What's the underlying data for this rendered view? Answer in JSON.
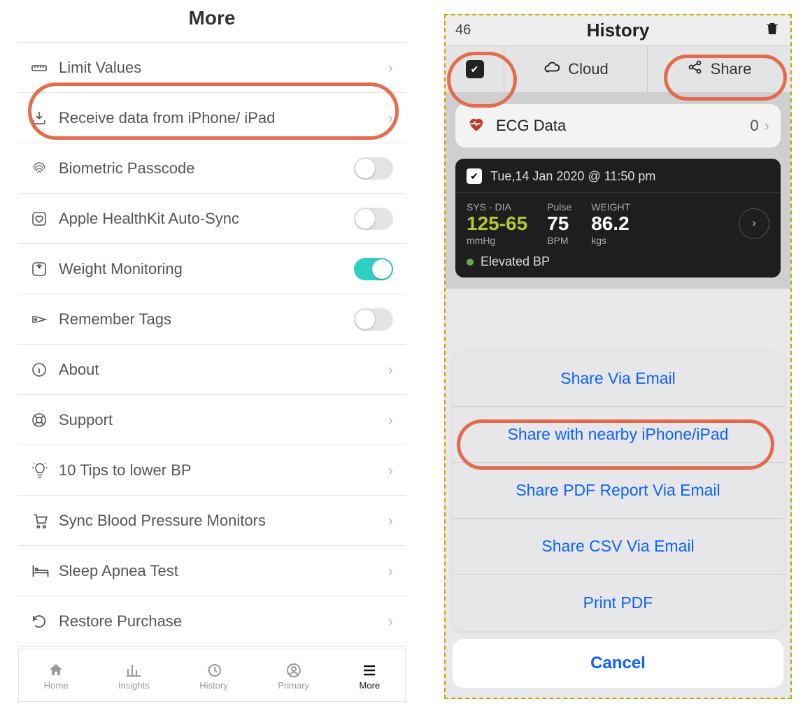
{
  "left": {
    "title": "More",
    "rows": [
      {
        "label": "Limit Values",
        "icon": "ruler",
        "type": "disclosure"
      },
      {
        "label": "Receive data from iPhone/ iPad",
        "icon": "download",
        "type": "disclosure"
      },
      {
        "label": "Biometric Passcode",
        "icon": "fingerprint",
        "type": "toggle",
        "on": false
      },
      {
        "label": "Apple HealthKit Auto-Sync",
        "icon": "heart-square",
        "type": "toggle",
        "on": false
      },
      {
        "label": "Weight Monitoring",
        "icon": "scale",
        "type": "toggle",
        "on": true
      },
      {
        "label": "Remember Tags",
        "icon": "tag",
        "type": "toggle",
        "on": false
      },
      {
        "label": "About",
        "icon": "info",
        "type": "disclosure"
      },
      {
        "label": "Support",
        "icon": "lifebuoy",
        "type": "disclosure"
      },
      {
        "label": "10 Tips to lower BP",
        "icon": "bulb",
        "type": "disclosure"
      },
      {
        "label": "Sync Blood Pressure Monitors",
        "icon": "cart",
        "type": "disclosure"
      },
      {
        "label": "Sleep Apnea Test",
        "icon": "bed",
        "type": "disclosure"
      },
      {
        "label": "Restore Purchase",
        "icon": "restore",
        "type": "disclosure"
      }
    ],
    "tabs": [
      {
        "label": "Home",
        "icon": "home"
      },
      {
        "label": "Insights",
        "icon": "chart"
      },
      {
        "label": "History",
        "icon": "clock"
      },
      {
        "label": "Primary",
        "icon": "user"
      },
      {
        "label": "More",
        "icon": "menu",
        "active": true
      }
    ]
  },
  "right": {
    "count": "46",
    "title": "History",
    "seg": {
      "cloud": "Cloud",
      "share": "Share"
    },
    "ecg": {
      "label": "ECG Data",
      "count": "0"
    },
    "card": {
      "timestamp": "Tue,14 Jan 2020 @ 11:50 pm",
      "sysdia_caption": "SYS - DIA",
      "sysdia_value": "125-65",
      "sysdia_unit": "mmHg",
      "pulse_caption": "Pulse",
      "pulse_value": "75",
      "pulse_unit": "BPM",
      "weight_caption": "WEIGHT",
      "weight_value": "86.2",
      "weight_unit": "kgs",
      "status": "Elevated BP"
    },
    "sheet": [
      "Share Via Email",
      "Share with nearby iPhone/iPad",
      "Share PDF Report Via Email",
      "Share CSV Via Email",
      "Print PDF"
    ],
    "cancel": "Cancel"
  }
}
